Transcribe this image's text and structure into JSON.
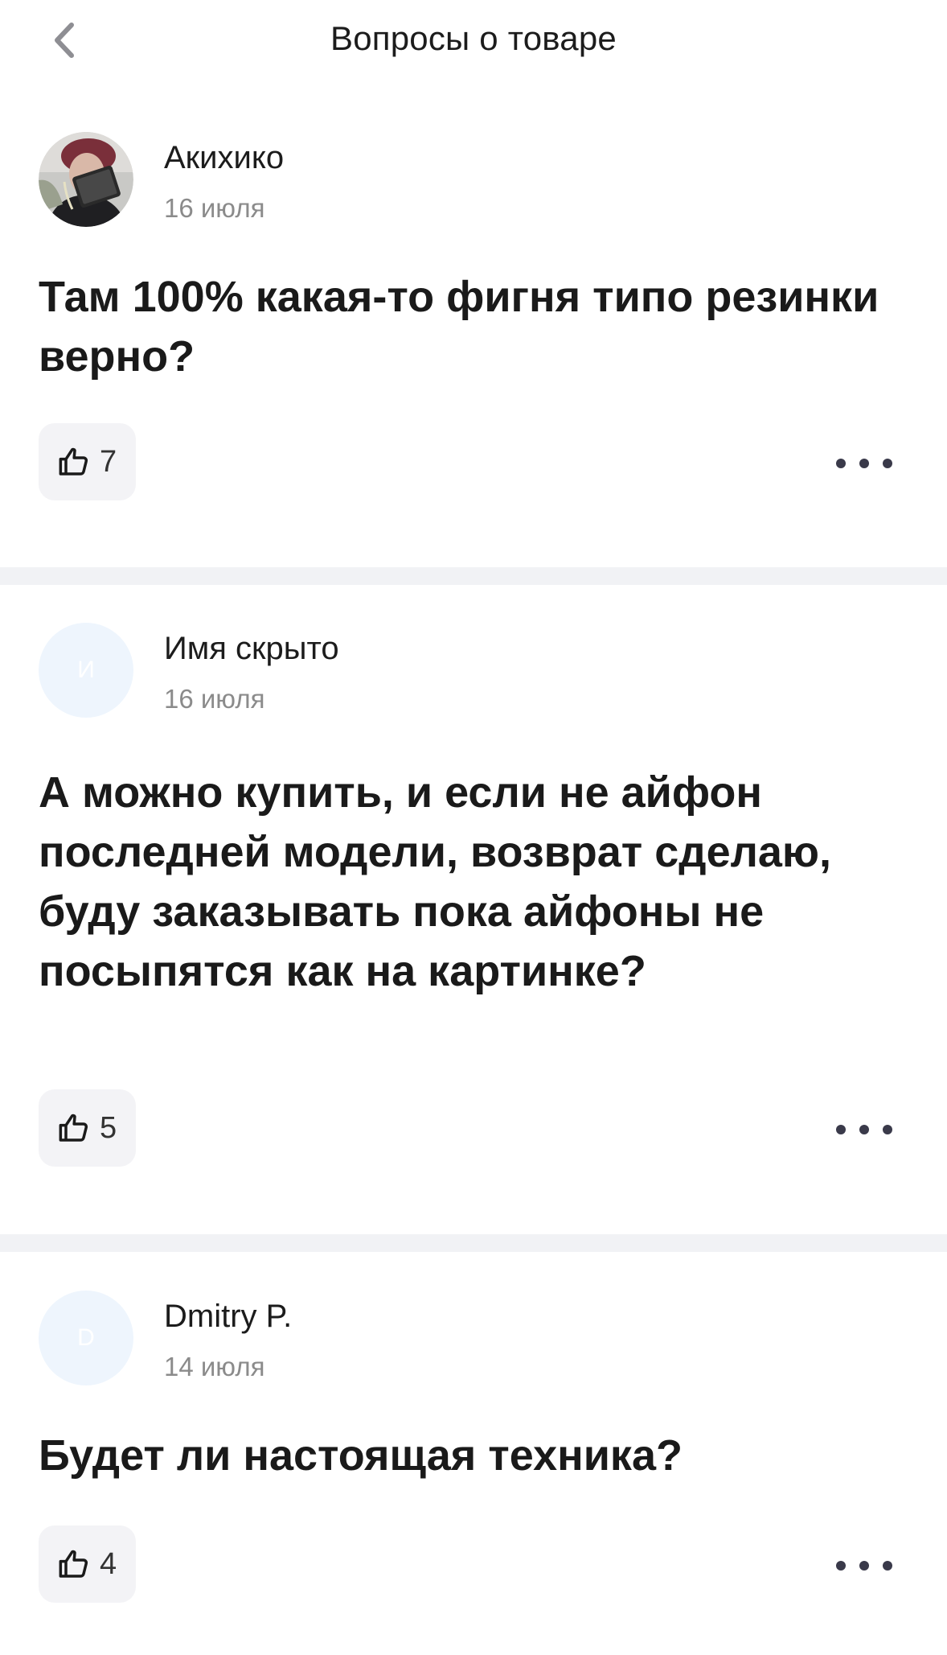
{
  "header": {
    "title": "Вопросы о товаре"
  },
  "questions": [
    {
      "author": "Акихико",
      "avatar_letter": "",
      "date": "16 июля",
      "text": "Там 100% какая-то фигня типо резинки верно?",
      "likes": "7"
    },
    {
      "author": "Имя скрыто",
      "avatar_letter": "И",
      "date": "16 июля",
      "text": "А можно купить, и если не айфон последней модели, возврат сделаю,  буду заказывать пока айфоны не посыпятся как на картинке?",
      "likes": "5"
    },
    {
      "author": "Dmitry P.",
      "avatar_letter": "D",
      "date": "14 июля",
      "text": "Будет ли настоящая техника?",
      "likes": "4"
    }
  ],
  "colors": {
    "avatar_placeholder_bg": "#eef5fd",
    "like_button_bg": "#f3f3f6",
    "divider": "#f1f2f5",
    "date_text": "#8b8b8b"
  }
}
